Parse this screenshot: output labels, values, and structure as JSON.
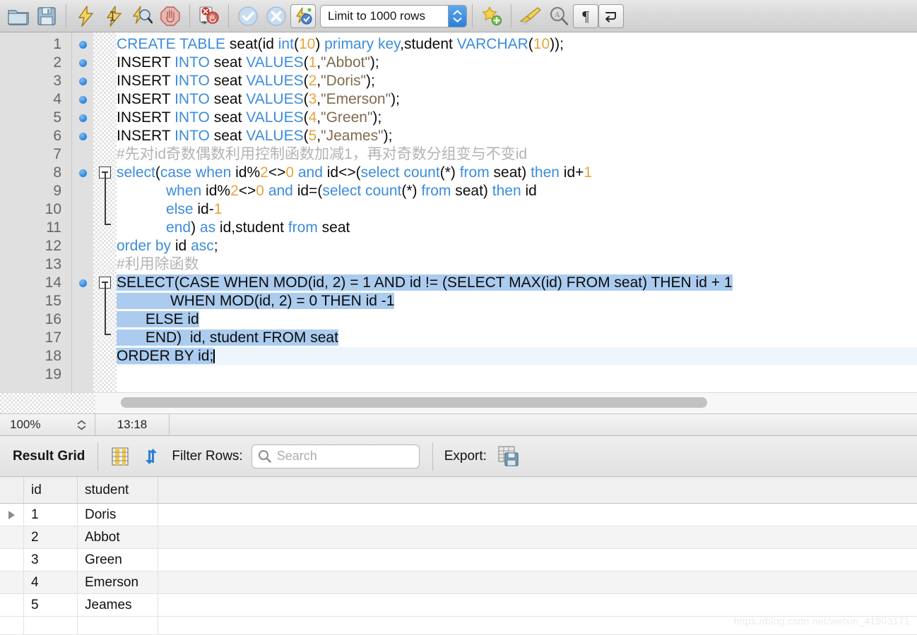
{
  "toolbar": {
    "buttons": [
      {
        "name": "open-script-icon",
        "title": "Open SQL Script"
      },
      {
        "name": "save-script-icon",
        "title": "Save SQL Script"
      },
      {
        "name": "execute-icon",
        "title": "Execute"
      },
      {
        "name": "execute-current-statement-icon",
        "title": "Execute Current Statement"
      },
      {
        "name": "explain-icon",
        "title": "Explain Current Statement"
      },
      {
        "name": "stop-icon",
        "title": "Stop"
      },
      {
        "name": "stop-on-error-icon",
        "title": "Toggle whether execution should stop on errors"
      },
      {
        "name": "commit-icon",
        "title": "Commit"
      },
      {
        "name": "rollback-icon",
        "title": "Rollback"
      },
      {
        "name": "autocommit-icon",
        "title": "Toggle Auto-Commit"
      },
      {
        "name": "beautify-icon",
        "title": "Beautify SQL"
      },
      {
        "name": "find-icon",
        "title": "Find"
      },
      {
        "name": "invisible-chars-icon",
        "title": "Toggle invisible characters"
      },
      {
        "name": "wrap-lines-icon",
        "title": "Wrap long lines"
      }
    ],
    "limit_selector": {
      "value": "Limit to 1000 rows"
    }
  },
  "editor": {
    "lines": [
      {
        "n": "1",
        "marker": true,
        "fold": "none"
      },
      {
        "n": "2",
        "marker": true,
        "fold": "none"
      },
      {
        "n": "3",
        "marker": true,
        "fold": "none"
      },
      {
        "n": "4",
        "marker": true,
        "fold": "none"
      },
      {
        "n": "5",
        "marker": true,
        "fold": "none"
      },
      {
        "n": "6",
        "marker": true,
        "fold": "none"
      },
      {
        "n": "7",
        "marker": false,
        "fold": "none"
      },
      {
        "n": "8",
        "marker": true,
        "fold": "open"
      },
      {
        "n": "9",
        "marker": false,
        "fold": "bar"
      },
      {
        "n": "10",
        "marker": false,
        "fold": "bar"
      },
      {
        "n": "11",
        "marker": false,
        "fold": "end"
      },
      {
        "n": "12",
        "marker": false,
        "fold": "none"
      },
      {
        "n": "13",
        "marker": false,
        "fold": "none"
      },
      {
        "n": "14",
        "marker": true,
        "fold": "open"
      },
      {
        "n": "15",
        "marker": false,
        "fold": "bar"
      },
      {
        "n": "16",
        "marker": false,
        "fold": "bar"
      },
      {
        "n": "17",
        "marker": false,
        "fold": "end"
      },
      {
        "n": "18",
        "marker": false,
        "fold": "none"
      },
      {
        "n": "19",
        "marker": false,
        "fold": "none"
      }
    ],
    "code_text": [
      "CREATE TABLE seat(id int(10) primary key,student VARCHAR(10));",
      "INSERT INTO seat VALUES(1,\"Abbot\");",
      "INSERT INTO seat VALUES(2,\"Doris\");",
      "INSERT INTO seat VALUES(3,\"Emerson\");",
      "INSERT INTO seat VALUES(4,\"Green\");",
      "INSERT INTO seat VALUES(5,\"Jeames\");",
      "#先对id奇数偶数利用控制函数加减1，再对奇数分组变与不变id",
      "select(case when id%2<>0 and id<>(select count(*) from seat) then id+1",
      "            when id%2<>0 and id=(select count(*) from seat) then id",
      "            else id-1",
      "            end) as id,student from seat",
      "order by id asc;",
      "#利用除函数",
      "SELECT(CASE WHEN MOD(id, 2) = 1 AND id != (SELECT MAX(id) FROM seat) THEN id + 1",
      "             WHEN MOD(id, 2) = 0 THEN id -1",
      "       ELSE id",
      "       END)  id, student FROM seat",
      "ORDER BY id;",
      ""
    ],
    "selection_lines": [
      14,
      15,
      16,
      17,
      18
    ],
    "cursor_line": 18,
    "colors": {
      "keyword": "#3c8cdc",
      "number": "#e8a33d",
      "string": "#7f6a4f",
      "comment": "#b3b3b3",
      "selection": "#abccef",
      "current_line": "#eef6fd"
    }
  },
  "statusbar": {
    "zoom": "100%",
    "time": "13:18"
  },
  "result_toolbar": {
    "title": "Result Grid",
    "grid_view_icon": "grid-view-icon",
    "refresh_icon": "refresh-icon",
    "filter_label": "Filter Rows:",
    "search_placeholder": "Search",
    "export_label": "Export:",
    "export_icon": "export-icon"
  },
  "grid": {
    "columns": [
      "id",
      "student"
    ],
    "rows": [
      {
        "id": "1",
        "student": "Doris",
        "selected": true
      },
      {
        "id": "2",
        "student": "Abbot",
        "selected": false
      },
      {
        "id": "3",
        "student": "Green",
        "selected": false
      },
      {
        "id": "4",
        "student": "Emerson",
        "selected": false
      },
      {
        "id": "5",
        "student": "Jeames",
        "selected": false
      }
    ]
  },
  "watermark": "https://blog.csdn.net/weixin_41903171"
}
